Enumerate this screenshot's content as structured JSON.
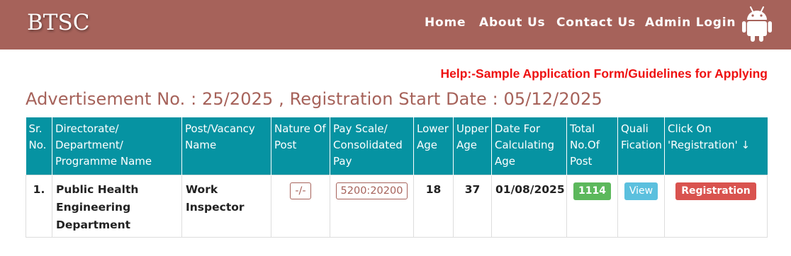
{
  "header": {
    "brand": "BTSC",
    "nav": [
      "Home",
      "About Us",
      "Contact Us",
      "Admin Login"
    ],
    "android_icon": "android-icon",
    "bg_color": "#a6625a"
  },
  "help_link": "Help:-Sample Application Form/Guidelines for Applying",
  "advertisement_heading": "Advertisement No. : 25/2025 , Registration Start Date : 05/12/2025",
  "table": {
    "header_color": "#0693a2",
    "columns": [
      "Sr. No.",
      "Directorate/ Department/ Programme Name",
      "Post/Vacancy Name",
      "Nature Of Post",
      "Pay Scale/ Consolidated Pay",
      "Lower Age",
      "Upper Age",
      "Date For Calculating Age",
      "Total No.Of Post",
      "Quali Fication",
      "Click On 'Registration' ↓"
    ],
    "rows": [
      {
        "sr": "1.",
        "department": "Public Health Engineering Department",
        "post": "Work Inspector",
        "nature": "-/-",
        "pay_scale": "5200:20200",
        "lower_age": "18",
        "upper_age": "37",
        "age_date": "01/08/2025",
        "total_posts": "1114",
        "qualification": "View",
        "registration": "Registration"
      }
    ]
  }
}
